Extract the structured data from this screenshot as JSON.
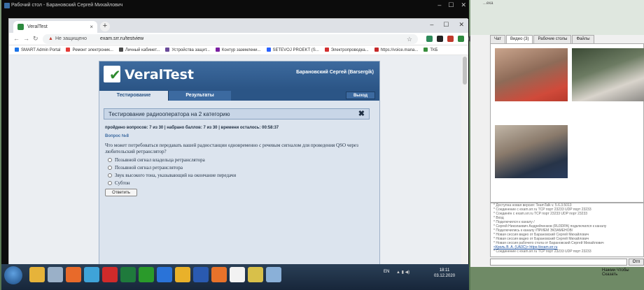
{
  "remote_window": {
    "title": "Рабочий стол - Барановский Сергей Михайлович",
    "controls": [
      "–",
      "☐",
      "✕"
    ]
  },
  "browser": {
    "tab_title": "VeralTest",
    "tab_close": "×",
    "new_tab": "+",
    "window_controls": [
      "–",
      "☐",
      "✕"
    ],
    "security_label": "Не защищено",
    "url": "exam.srr.ru/testview",
    "bookmarks": [
      "SMART Admin Portal",
      "Ремонт электроник...",
      "Личный кабинет...",
      "Устройства защит...",
      "Контур заземлени...",
      "SETEVOJ PROEKT (S...",
      "Электропроводка...",
      "https://voice.mana...",
      "ТКБ"
    ],
    "bookmark_colors": [
      "#1a73e8",
      "#e53935",
      "#4a4a4a",
      "#6a4a9a",
      "#7b1fa2",
      "#2962ff",
      "#d32f2f",
      "#c62828",
      "#388e3c"
    ]
  },
  "veraltest": {
    "logo_text": "VeralTest",
    "user": "Барановский Сергей (Barsergik)",
    "tabs": {
      "test": "Тестирование",
      "results": "Результаты"
    },
    "exit": "Выход",
    "test_title": "Тестирование радиооператора на 2 категорию",
    "close_symbol": "✖",
    "progress": "пройдено вопросов: 7 из 30 | набрано баллов: 7 из 30 | времени осталось: 00:58:37",
    "question_number": "Вопрос №8",
    "question_text": "Что может потребоваться передавать вашей радиостанции одновременно с речевым сигналом для проведения QSO через любительский ретранслятор?",
    "answers": [
      "Позывной сигнал владельца ретранслятора",
      "Позывной сигнал ретранслятора",
      "Звук высокого тона, указывающий на окончание передачи",
      "Субтон"
    ],
    "submit": "Ответить"
  },
  "taskbar": {
    "lang": "EN",
    "time": "18:11",
    "date": "03.12.2020",
    "icons": [
      "explorer",
      "notepad",
      "media",
      "tools",
      "opera",
      "excel",
      "antivirus",
      "ie",
      "chrome",
      "word",
      "firefox",
      "clapper",
      "teamtalk",
      "pen"
    ],
    "icon_colors": [
      "#e6b33a",
      "#9ab0c8",
      "#e86a2a",
      "#3fa3d8",
      "#d02a2a",
      "#1f7a3c",
      "#2a9a2a",
      "#2a73d8",
      "#e9b12a",
      "#2a5ab0",
      "#e8722a",
      "#f2f2f2",
      "#d8c04a",
      "#8ab0d8"
    ]
  },
  "teamtalk": {
    "top_label": "...ека",
    "tabs": [
      "Чат",
      "Видео (3)",
      "Рабочие столы",
      "Файлы"
    ],
    "log": [
      "* Доступна новая версия: TeamTalk v. 5.6.3.5013",
      "* Соединение с exam.srr.ru TCP порт 23233 UDP порт 23233",
      "* Соединён с exam.srr.ru TCP порт 23233 UDP порт 23233",
      "* Вход",
      "* Подключился к каналу /",
      "* Сергей Николаевич Андрейченков (RU3DPA) подключился к каналу",
      "* Подключились к каналу /ПРИЕМ ЭКЗАМЕНОВ/",
      "* Новая сессия видео от Барановский Сергей Михайлович",
      "* Новая сессия видео от Барановский Сергей Михайлович",
      "* Новая сессия рабочего стола от Барановский Сергей Михайлович",
      "<Кроль В. А. (UA3C)> https://exam.srr.ru",
      "* Соединение с exam.srr.ru TCP порт 23233 UDP порт 23233"
    ],
    "send": "Отп",
    "ptt": "Нажми Чтобы Сказать"
  }
}
